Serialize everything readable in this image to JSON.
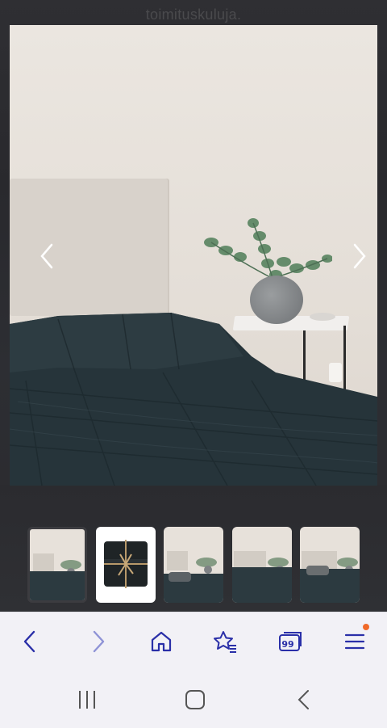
{
  "page": {
    "top_text": "toimitusk­uluja."
  },
  "gallery": {
    "main_image_alt": "",
    "thumbnails": [
      {
        "id": "thumb-1",
        "selected": true
      },
      {
        "id": "thumb-2",
        "selected": false
      },
      {
        "id": "thumb-3",
        "selected": false
      },
      {
        "id": "thumb-4",
        "selected": false
      },
      {
        "id": "thumb-5",
        "selected": false
      }
    ]
  },
  "toolbar": {
    "tabs_count": "99",
    "icons": [
      "back-icon",
      "forward-icon",
      "home-icon",
      "bookmarks-icon",
      "tabs-icon",
      "menu-icon"
    ],
    "accent_color": "#2a2fa8",
    "badge_color": "#f06a2a"
  },
  "system_nav": {
    "icons": [
      "recent-apps-icon",
      "home-button-icon",
      "system-back-icon"
    ]
  }
}
